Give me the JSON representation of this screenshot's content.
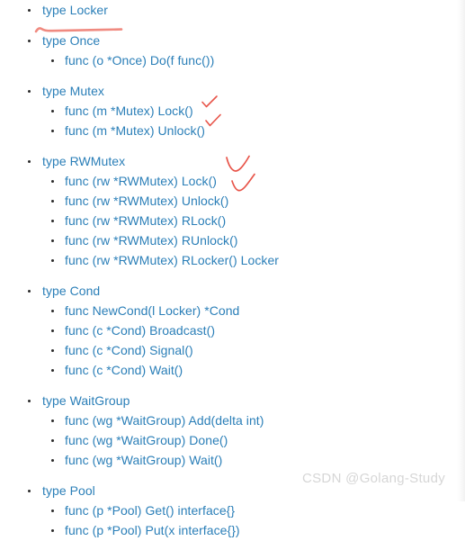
{
  "page": {
    "background_color": "#ffffff",
    "link_color": "#2b7fb8",
    "annotation_color": "#e8554a",
    "watermark_color": "#d6d6d6"
  },
  "watermark": {
    "text": "CSDN @Golang-Study"
  },
  "outline": {
    "groups": [
      {
        "type_label": "type Locker",
        "funcs": []
      },
      {
        "type_label": "type Once",
        "funcs": [
          {
            "label": "func (o *Once) Do(f func())"
          }
        ]
      },
      {
        "type_label": "type Mutex",
        "funcs": [
          {
            "label": "func (m *Mutex) Lock()"
          },
          {
            "label": "func (m *Mutex) Unlock()"
          }
        ]
      },
      {
        "type_label": "type RWMutex",
        "funcs": [
          {
            "label": "func (rw *RWMutex) Lock()"
          },
          {
            "label": "func (rw *RWMutex) Unlock()"
          },
          {
            "label": "func (rw *RWMutex) RLock()"
          },
          {
            "label": "func (rw *RWMutex) RUnlock()"
          },
          {
            "label": "func (rw *RWMutex) RLocker() Locker"
          }
        ]
      },
      {
        "type_label": "type Cond",
        "funcs": [
          {
            "label": "func NewCond(l Locker) *Cond"
          },
          {
            "label": "func (c *Cond) Broadcast()"
          },
          {
            "label": "func (c *Cond) Signal()"
          },
          {
            "label": "func (c *Cond) Wait()"
          }
        ]
      },
      {
        "type_label": "type WaitGroup",
        "funcs": [
          {
            "label": "func (wg *WaitGroup) Add(delta int)"
          },
          {
            "label": "func (wg *WaitGroup) Done()"
          },
          {
            "label": "func (wg *WaitGroup) Wait()"
          }
        ]
      },
      {
        "type_label": "type Pool",
        "funcs": [
          {
            "label": "func (p *Pool) Get() interface{}"
          },
          {
            "label": "func (p *Pool) Put(x interface{})"
          }
        ]
      }
    ]
  },
  "annotations": [
    {
      "name": "underline-type-locker",
      "kind": "underline",
      "target": "type Locker"
    },
    {
      "name": "checkmark-mutex-lock",
      "kind": "checkmark",
      "target": "func (m *Mutex) Lock()"
    },
    {
      "name": "checkmark-mutex-unlock",
      "kind": "checkmark",
      "target": "func (m *Mutex) Unlock()"
    },
    {
      "name": "checkmark-rwmutex-lock",
      "kind": "checkmark",
      "target": "func (rw *RWMutex) Lock()"
    },
    {
      "name": "checkmark-rwmutex-unlock",
      "kind": "checkmark",
      "target": "func (rw *RWMutex) Unlock()"
    }
  ]
}
